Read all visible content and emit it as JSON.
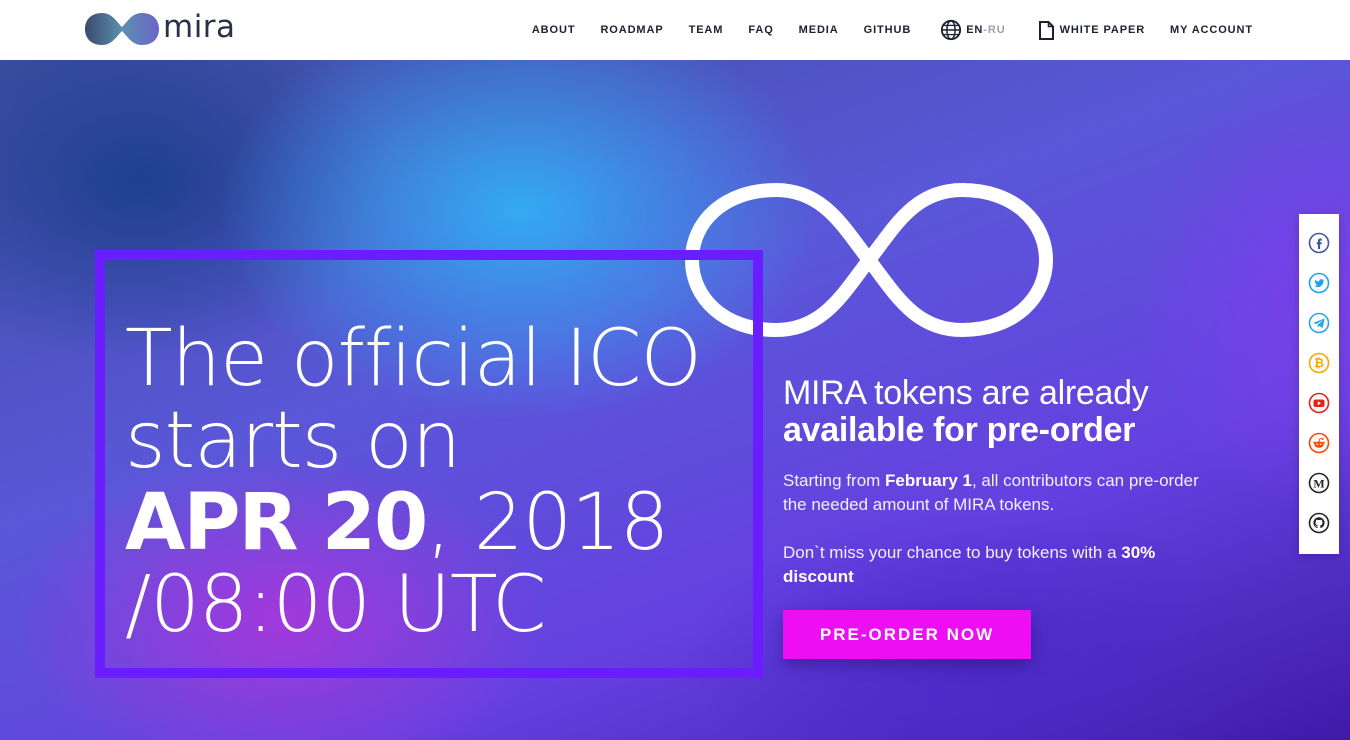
{
  "brand": {
    "name": "mira"
  },
  "nav": {
    "items": [
      {
        "label": "ABOUT"
      },
      {
        "label": "ROADMAP"
      },
      {
        "label": "TEAM"
      },
      {
        "label": "FAQ"
      },
      {
        "label": "MEDIA"
      },
      {
        "label": "GITHUB"
      }
    ],
    "lang_current": "EN",
    "lang_sep": "-",
    "lang_other": "RU",
    "white_paper": "WHITE PAPER",
    "account": "MY ACCOUNT"
  },
  "hero": {
    "line1": "The official ICO",
    "line2": "starts on",
    "date_strong": "APR 20",
    "date_rest": ", 2018",
    "time": "/08:00 UTC"
  },
  "promo": {
    "title_light": "MIRA tokens are already",
    "title_bold": "available for pre-order",
    "p1_before": "Starting from ",
    "p1_strong": "February 1",
    "p1_after": ", all contributors can pre-order the needed amount of MIRA tokens.",
    "p2_before": "Don`t miss your chance to buy tokens with a ",
    "p2_strong": "30% discount",
    "cta_label": "PRE-ORDER NOW"
  },
  "social": [
    {
      "icon": "facebook-icon",
      "color": "#3b5998"
    },
    {
      "icon": "twitter-icon",
      "color": "#1da1f2"
    },
    {
      "icon": "telegram-icon",
      "color": "#2ca5e0"
    },
    {
      "icon": "bitcoin-icon",
      "color": "#f7a600"
    },
    {
      "icon": "youtube-icon",
      "color": "#e62117"
    },
    {
      "icon": "reddit-icon",
      "color": "#ff4500"
    },
    {
      "icon": "medium-icon",
      "color": "#222222"
    },
    {
      "icon": "github-icon",
      "color": "#222222"
    }
  ],
  "colors": {
    "accent_frame": "#6a1eff",
    "cta": "#ee0ef3",
    "nav_text": "#1c2030"
  }
}
